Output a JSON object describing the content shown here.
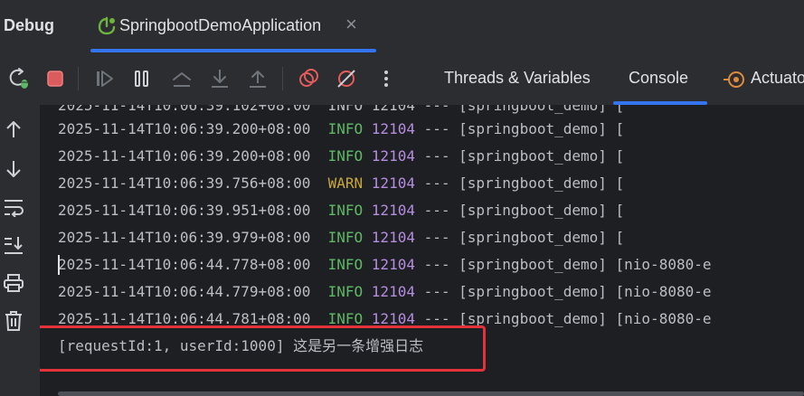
{
  "panel": {
    "title": "Debug"
  },
  "run_tab": {
    "label": "SpringbootDemoApplication",
    "close_glyph": "×"
  },
  "toolbar": {
    "buttons": [
      {
        "name": "rerun-debug-icon"
      },
      {
        "name": "stop-icon"
      },
      {
        "name": "resume-icon"
      },
      {
        "name": "pause-icon"
      },
      {
        "name": "step-over-icon"
      },
      {
        "name": "step-into-icon"
      },
      {
        "name": "step-out-icon"
      },
      {
        "name": "view-breakpoints-icon"
      },
      {
        "name": "mute-breakpoints-icon"
      },
      {
        "name": "more-icon"
      }
    ],
    "tabs": {
      "threads": "Threads & Variables",
      "console": "Console",
      "actuator": "Actuato"
    }
  },
  "gutter": {
    "buttons": [
      "up-arrow-icon",
      "down-arrow-icon",
      "soft-wrap-icon",
      "scroll-to-end-icon",
      "print-icon",
      "trash-icon"
    ]
  },
  "console": {
    "partial_top": "2025-11-14T10:06:39.102+08:00  INFO 12104 --- [springboot_demo] [",
    "lines": [
      {
        "ts": "2025-11-14T10:06:39.200+08:00",
        "level": "INFO",
        "pid": "12104",
        "rest": " --- [springboot_demo] ["
      },
      {
        "ts": "2025-11-14T10:06:39.200+08:00",
        "level": "INFO",
        "pid": "12104",
        "rest": " --- [springboot_demo] ["
      },
      {
        "ts": "2025-11-14T10:06:39.756+08:00",
        "level": "WARN",
        "pid": "12104",
        "rest": " --- [springboot_demo] ["
      },
      {
        "ts": "2025-11-14T10:06:39.951+08:00",
        "level": "INFO",
        "pid": "12104",
        "rest": " --- [springboot_demo] ["
      },
      {
        "ts": "2025-11-14T10:06:39.979+08:00",
        "level": "INFO",
        "pid": "12104",
        "rest": " --- [springboot_demo] ["
      },
      {
        "ts": "2025-11-14T10:06:44.778+08:00",
        "level": "INFO",
        "pid": "12104",
        "rest": " --- [springboot_demo] [nio-8080-e"
      },
      {
        "ts": "2025-11-14T10:06:44.779+08:00",
        "level": "INFO",
        "pid": "12104",
        "rest": " --- [springboot_demo] [nio-8080-e"
      },
      {
        "ts": "2025-11-14T10:06:44.781+08:00",
        "level": "INFO",
        "pid": "12104",
        "rest": " --- [springboot_demo] [nio-8080-e"
      }
    ],
    "custom_message": "[requestId:1, userId:1000] 这是另一条增强日志"
  },
  "colors": {
    "accent": "#3574f0",
    "info": "#5fb865",
    "warn": "#c9a83a",
    "pid": "#b58ee0",
    "highlight": "#e5323a"
  }
}
